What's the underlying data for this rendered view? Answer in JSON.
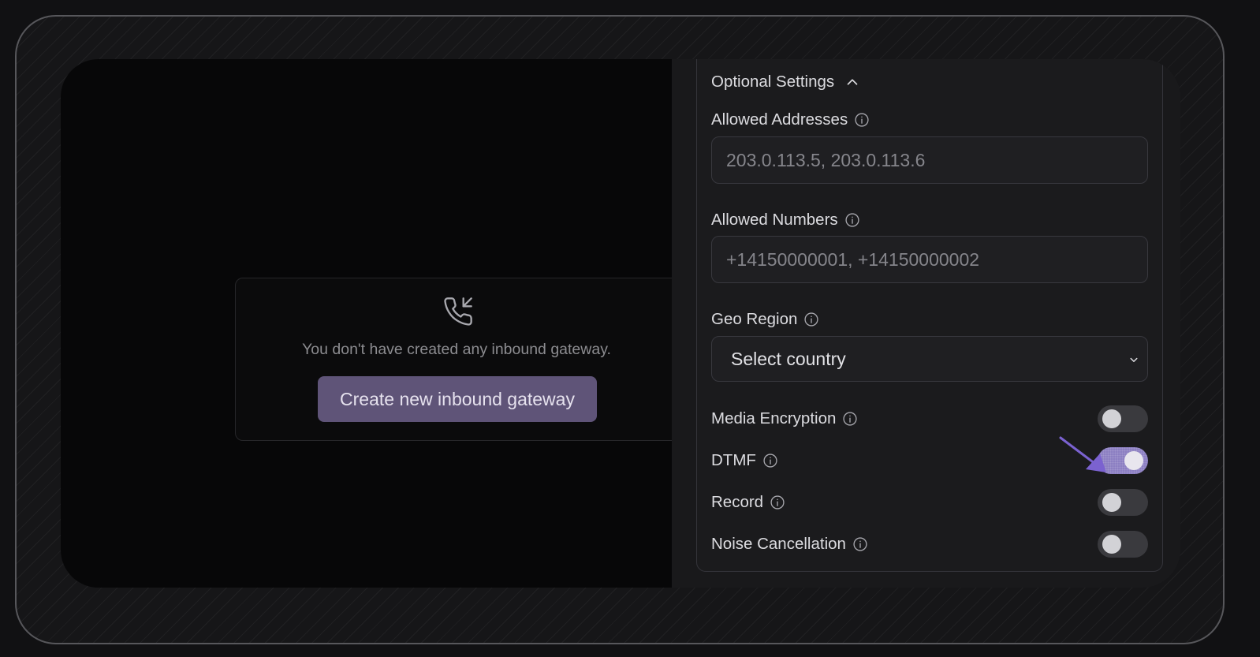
{
  "empty_state": {
    "message": "You don't have created any inbound gateway.",
    "create_button_label": "Create new inbound gateway",
    "icon": "phone-incoming-icon"
  },
  "settings": {
    "section_title": "Optional Settings",
    "allowed_addresses": {
      "label": "Allowed Addresses",
      "placeholder": "203.0.113.5, 203.0.113.6"
    },
    "allowed_numbers": {
      "label": "Allowed Numbers",
      "placeholder": "+14150000001, +14150000002"
    },
    "geo_region": {
      "label": "Geo Region",
      "selected": "Select country"
    },
    "toggles": [
      {
        "label": "Media Encryption",
        "on": false
      },
      {
        "label": "DTMF",
        "on": true
      },
      {
        "label": "Record",
        "on": false
      },
      {
        "label": "Noise Cancellation",
        "on": false
      }
    ]
  },
  "colors": {
    "accent": "#8c7fc2",
    "button": "#5f5478",
    "annotation_arrow": "#7b62d0"
  }
}
